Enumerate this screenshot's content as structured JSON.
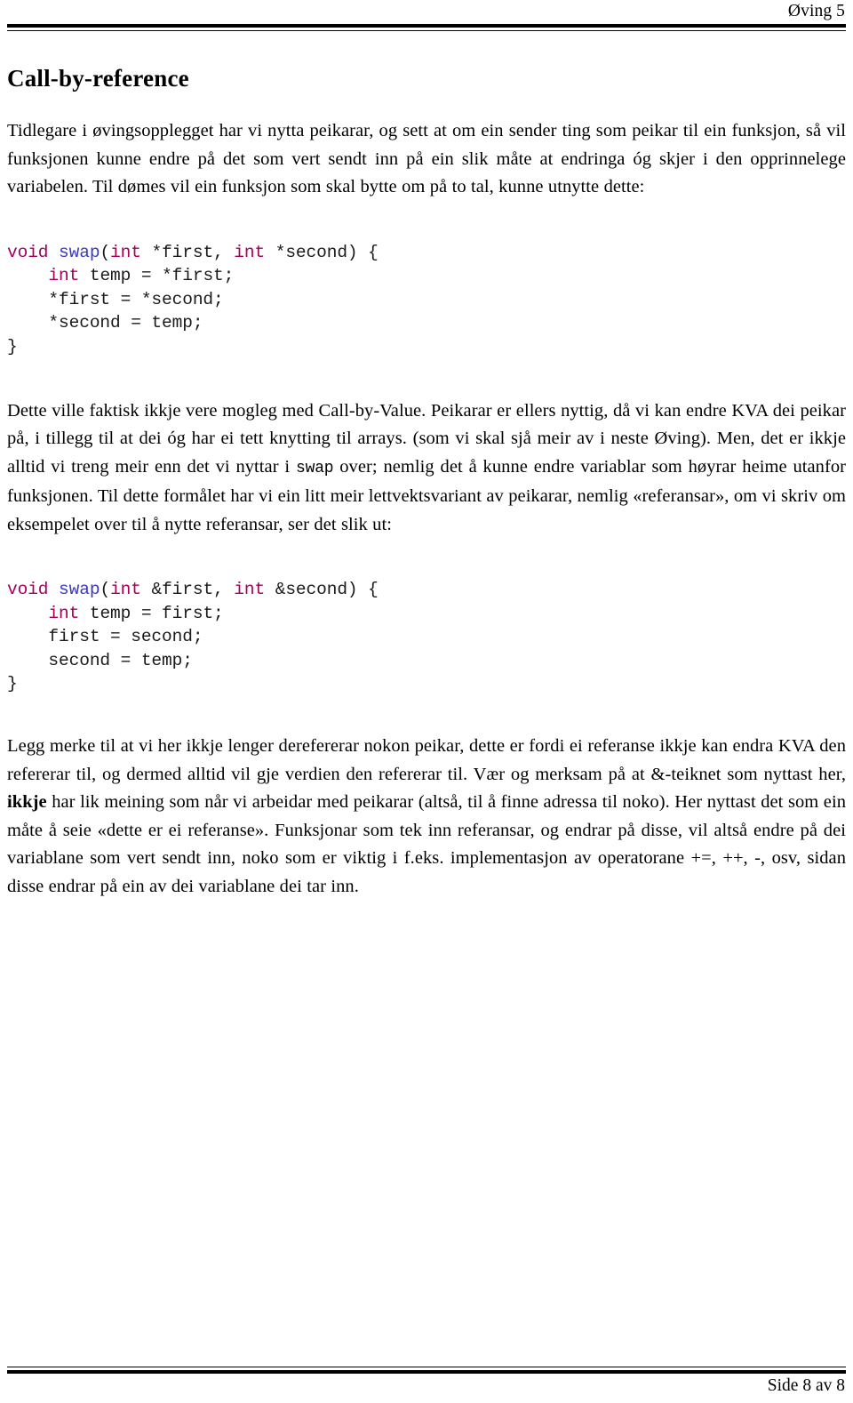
{
  "header": {
    "title": "Øving 5"
  },
  "footer": {
    "page_label": "Side 8 av 8"
  },
  "section": {
    "heading": "Call-by-reference"
  },
  "paragraphs": {
    "intro": "Tidlegare i øvingsopplegget har vi nytta peikarar, og sett at om ein sender ting som peikar til ein funksjon, så vil funksjonen kunne endre på det som vert sendt inn på ein slik måte at endringa óg skjer i den opprinnelege variabelen. Til dømes vil ein funksjon som skal bytte om på to tal, kunne utnytte dette:",
    "middle_1": "Dette ville faktisk ikkje vere mogleg med Call-by-Value. Peikarar er ellers nyttig, då vi kan endre KVA dei peikar på, i tillegg til at dei óg har ei tett knytting til arrays. (som vi skal sjå meir av i neste Øving). Men, det er ikkje alltid vi treng meir enn det vi nyttar i ",
    "middle_code": "swap",
    "middle_2": " over; nemlig det å kunne endre variablar som høyrar heime utanfor funksjonen. Til dette formålet har vi ein litt meir lettvektsvariant av peikarar, nemlig «referansar», om vi skriv om eksempelet over til å nytte referansar, ser det slik ut:",
    "final_1": "Legg merke til at vi her ikkje lenger derefererar nokon peikar, dette er fordi ei referanse ikkje kan endra KVA den refererar til, og dermed alltid vil gje verdien den refererar til. Vær og merksam på at &-teiknet som nyttast her, ",
    "final_bold": "ikkje",
    "final_2": " har lik meining som når vi arbeidar med peikarar (altså, til å finne adressa til noko). Her nyttast det som ein måte å seie «dette er ei referanse». Funksjonar som tek inn referansar, og endrar på disse, vil altså endre på dei variablane som vert sendt inn, noko som er viktig i f.eks. implementasjon av operatorane +=, ++, -, osv, sidan disse endrar på ein av dei variablane dei tar inn."
  },
  "code_blocks": {
    "pointer_version": {
      "lines": [
        [
          {
            "t": "void",
            "c": "kw"
          },
          {
            "t": " ",
            "c": "pl"
          },
          {
            "t": "swap",
            "c": "fn"
          },
          {
            "t": "(",
            "c": "pl"
          },
          {
            "t": "int",
            "c": "kw"
          },
          {
            "t": " *first, ",
            "c": "pl"
          },
          {
            "t": "int",
            "c": "kw"
          },
          {
            "t": " *second) {",
            "c": "pl"
          }
        ],
        [
          {
            "t": "    ",
            "c": "pl"
          },
          {
            "t": "int",
            "c": "kw"
          },
          {
            "t": " temp = *first;",
            "c": "pl"
          }
        ],
        [
          {
            "t": "    *first = *second;",
            "c": "pl"
          }
        ],
        [
          {
            "t": "    *second = temp;",
            "c": "pl"
          }
        ],
        [
          {
            "t": "}",
            "c": "pl"
          }
        ]
      ]
    },
    "reference_version": {
      "lines": [
        [
          {
            "t": "void",
            "c": "kw"
          },
          {
            "t": " ",
            "c": "pl"
          },
          {
            "t": "swap",
            "c": "fn"
          },
          {
            "t": "(",
            "c": "pl"
          },
          {
            "t": "int",
            "c": "kw"
          },
          {
            "t": " &first, ",
            "c": "pl"
          },
          {
            "t": "int",
            "c": "kw"
          },
          {
            "t": " &second) {",
            "c": "pl"
          }
        ],
        [
          {
            "t": "    ",
            "c": "pl"
          },
          {
            "t": "int",
            "c": "kw"
          },
          {
            "t": " temp = first;",
            "c": "pl"
          }
        ],
        [
          {
            "t": "    first = second;",
            "c": "pl"
          }
        ],
        [
          {
            "t": "    second = temp;",
            "c": "pl"
          }
        ],
        [
          {
            "t": "}",
            "c": "pl"
          }
        ]
      ]
    }
  },
  "colors": {
    "keyword": "#a3005c",
    "function": "#3b38c4",
    "plain": "#1a1a1a",
    "rule": "#000000"
  }
}
